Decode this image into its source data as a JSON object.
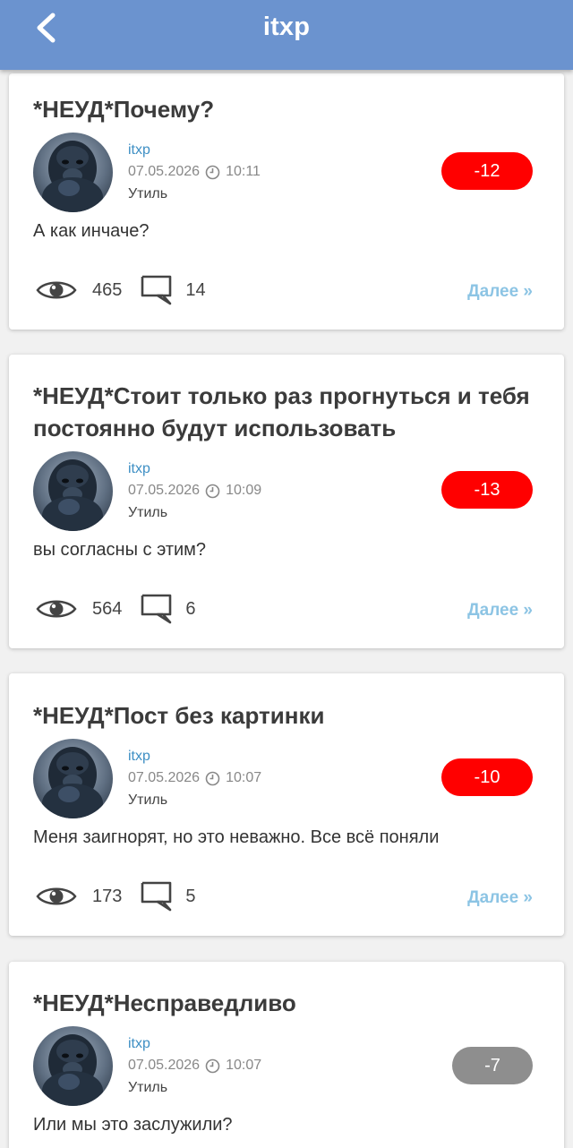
{
  "header": {
    "title": "itxp",
    "back_icon": "chevron-left-icon",
    "background": "#6b93cf"
  },
  "posts": [
    {
      "title": "*НЕУД*Почему?",
      "author": "itxp",
      "date": "07.05.2026",
      "time": "10:11",
      "category": "Утиль",
      "rating": "-12",
      "rating_color": "#ff0000",
      "excerpt": "А как инчаче?",
      "views": "465",
      "comments": "14",
      "more": "Далее »"
    },
    {
      "title": "*НЕУД*Стоит только раз прогнуться и тебя постоянно  будут использовать",
      "author": "itxp",
      "date": "07.05.2026",
      "time": "10:09",
      "category": "Утиль",
      "rating": "-13",
      "rating_color": "#ff0000",
      "excerpt": "вы согласны с этим?",
      "views": "564",
      "comments": "6",
      "more": "Далее »"
    },
    {
      "title": "*НЕУД*Пост без картинки",
      "author": "itxp",
      "date": "07.05.2026",
      "time": "10:07",
      "category": "Утиль",
      "rating": "-10",
      "rating_color": "#ff0000",
      "excerpt": "Меня заигнорят, но это неважно. Все всё поняли",
      "views": "173",
      "comments": "5",
      "more": "Далее »"
    },
    {
      "title": "*НЕУД*Несправедливо",
      "author": "itxp",
      "date": "07.05.2026",
      "time": "10:07",
      "category": "Утиль",
      "rating": "-7",
      "rating_color": "#8e8e8e",
      "excerpt": "Или мы это заслужили?"
    }
  ]
}
